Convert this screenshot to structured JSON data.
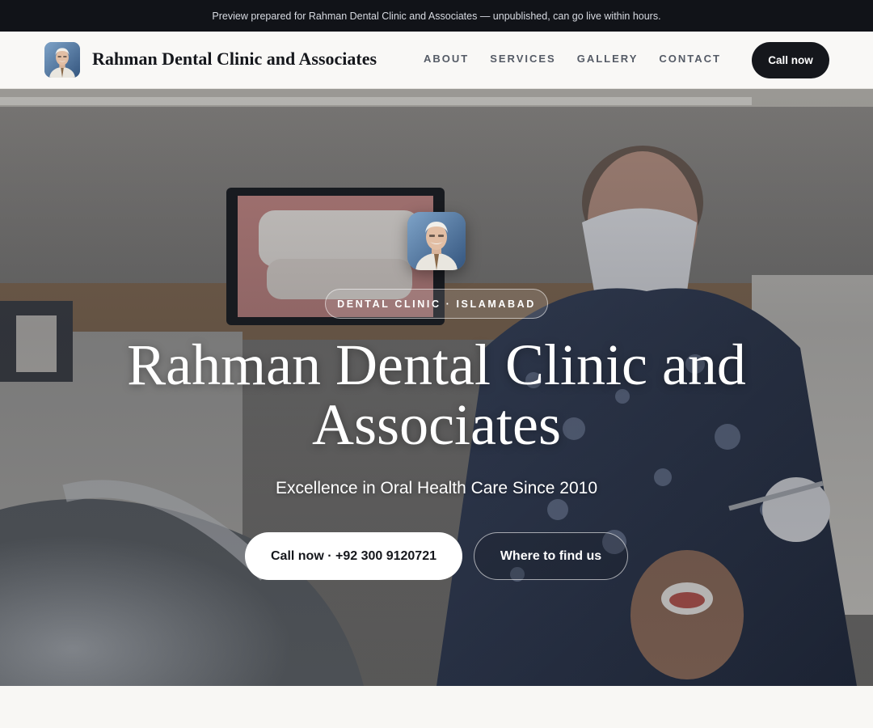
{
  "banner": {
    "text": "Preview prepared for Rahman Dental Clinic and Associates — unpublished, can go live within hours."
  },
  "nav": {
    "brand_name": "Rahman Dental Clinic and Associates",
    "links": [
      "ABOUT",
      "SERVICES",
      "GALLERY",
      "CONTACT"
    ],
    "cta_label": "Call now"
  },
  "hero": {
    "badge": "DENTAL CLINIC · ISLAMABAD",
    "title": "Rahman Dental Clinic and Associates",
    "subtitle": "Excellence in Oral Health Care Since 2010",
    "primary_button": "Call now · +92 300 9120721",
    "secondary_button": "Where to find us"
  },
  "colors": {
    "dark": "#15171c",
    "banner_bg": "#111318",
    "page_bg": "#f8f7f4"
  },
  "icons": {
    "brand_avatar": "doctor-portrait-icon",
    "hero_avatar": "doctor-portrait-icon"
  }
}
